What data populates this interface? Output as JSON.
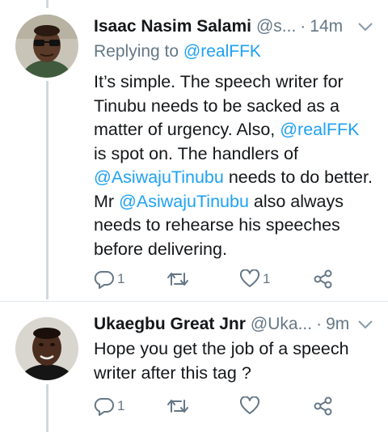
{
  "tweets": [
    {
      "name": "Isaac Nasim Salami",
      "handle": "@s...",
      "time": "14m",
      "replying_prefix": "Replying to ",
      "replying_handle": "@realFFK",
      "body_parts": [
        {
          "t": "It’s simple. The speech writer for Tinubu needs to be sacked as a matter of urgency. Also, ",
          "link": false
        },
        {
          "t": "@realFFK",
          "link": true
        },
        {
          "t": " is spot on. The handlers of ",
          "link": false
        },
        {
          "t": "@AsiwajuTinubu",
          "link": true
        },
        {
          "t": " needs to do better. Mr ",
          "link": false
        },
        {
          "t": "@AsiwajuTinubu",
          "link": true
        },
        {
          "t": " also always needs to rehearse his speeches before delivering.",
          "link": false
        }
      ],
      "reply_count": "1",
      "retweet_count": "",
      "like_count": "1"
    },
    {
      "name": "Ukaegbu Great Jnr",
      "handle": "@Uka...",
      "time": "9m",
      "body_parts": [
        {
          "t": "Hope you get the job of a speech writer after this tag ?",
          "link": false
        }
      ],
      "reply_count": "1",
      "retweet_count": "",
      "like_count": ""
    }
  ],
  "colors": {
    "link": "#1da1f2",
    "secondary_text": "#657786",
    "thread_line": "#cfd9de"
  },
  "icons": [
    "reply-icon",
    "retweet-icon",
    "like-icon",
    "share-icon",
    "chevron-down-icon"
  ]
}
